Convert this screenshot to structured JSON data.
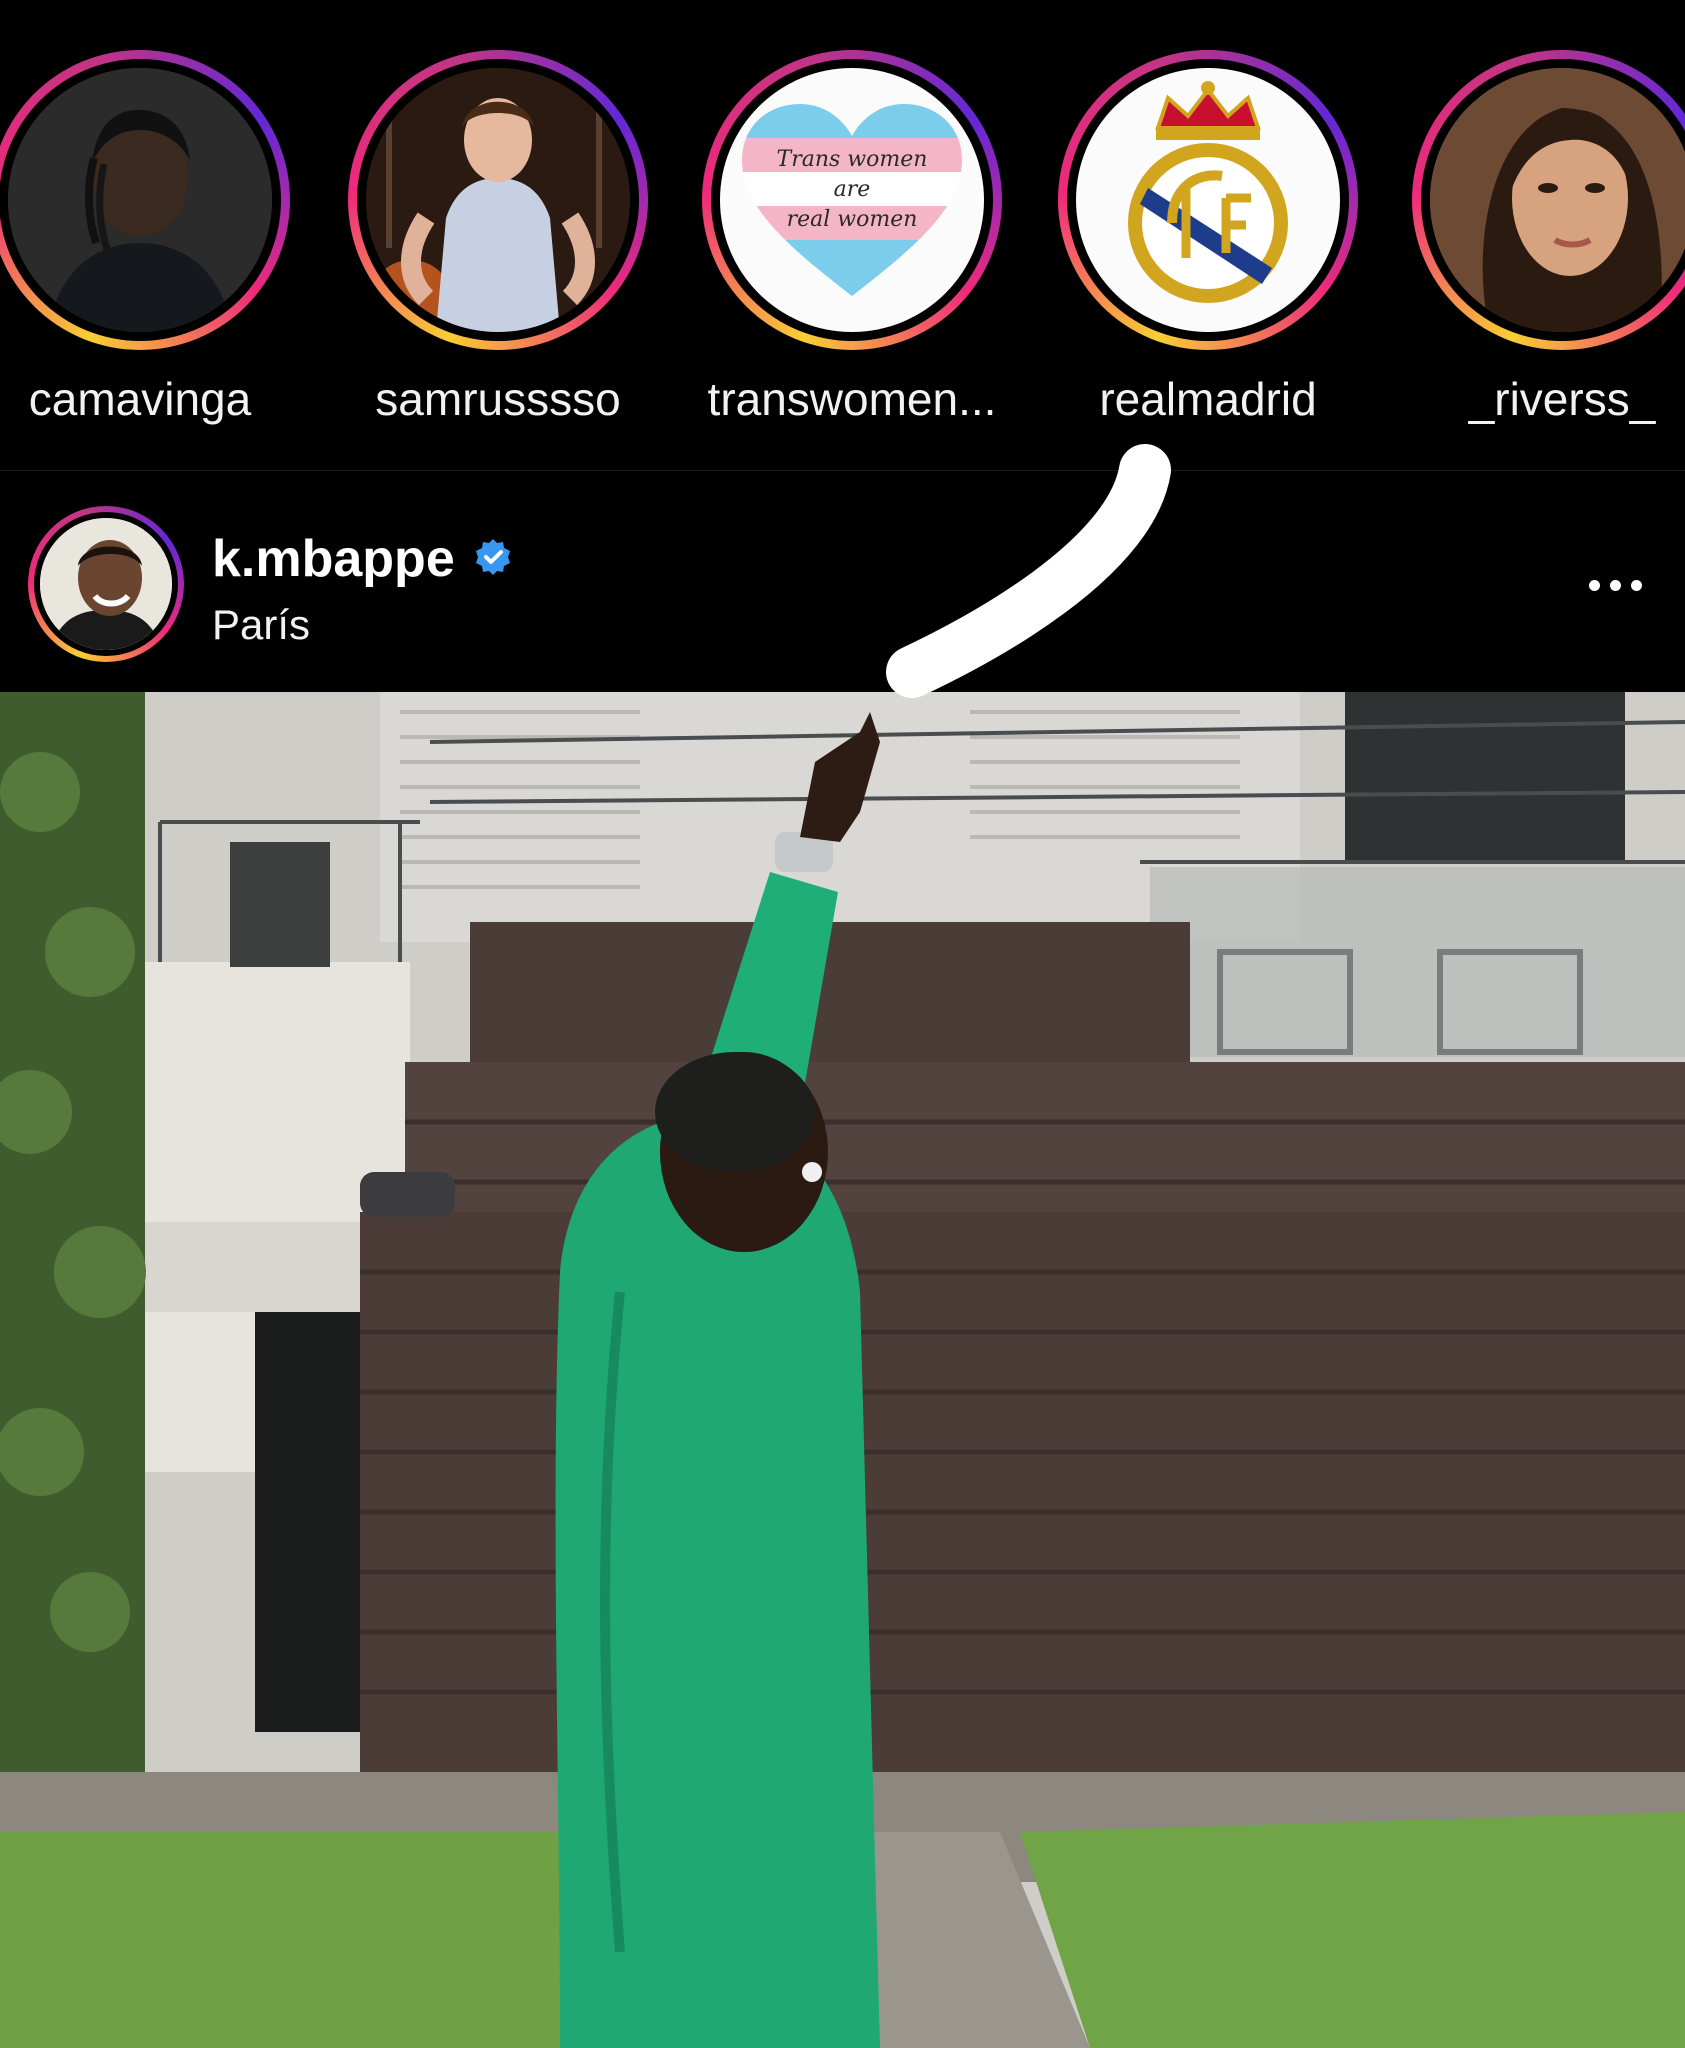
{
  "stories": [
    {
      "username": "camavinga",
      "avatar_icon": "profile-photo"
    },
    {
      "username": "samrusssso",
      "avatar_icon": "profile-photo"
    },
    {
      "username": "transwomen...",
      "avatar_icon": "heart-flag-image",
      "avatar_text": {
        "line1": "Trans women",
        "line2": "are",
        "line3": "real women"
      }
    },
    {
      "username": "realmadrid",
      "avatar_icon": "real-madrid-crest"
    },
    {
      "username": "_riverss_",
      "avatar_icon": "profile-photo"
    }
  ],
  "post": {
    "username": "k.mbappe",
    "verified_icon": "verified-badge-icon",
    "location": "París",
    "more_icon": "more-options-icon"
  },
  "colors": {
    "background": "#000000",
    "story_ring_gradient": [
      "#f9ce34",
      "#ee2a7b",
      "#6228d7"
    ],
    "verified_blue": "#3897f0",
    "annotation_white": "#ffffff"
  }
}
